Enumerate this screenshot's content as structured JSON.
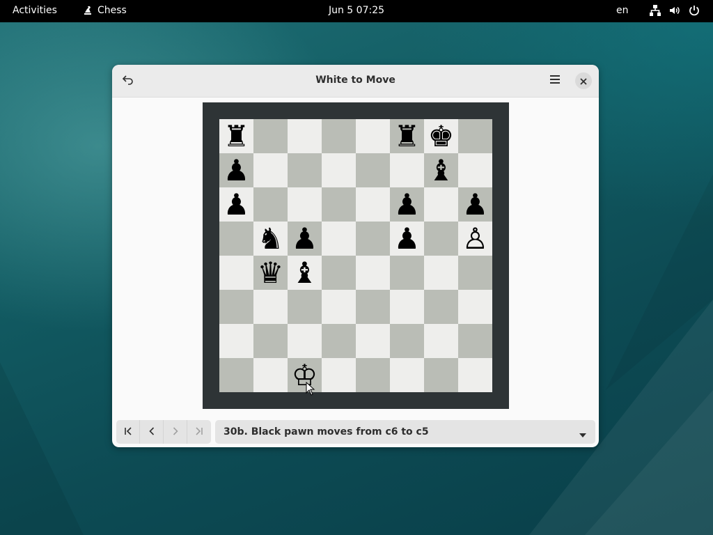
{
  "topbar": {
    "activities": "Activities",
    "app_name": "Chess",
    "clock": "Jun 5  07:25",
    "language": "en",
    "icons": [
      "network-icon",
      "volume-icon",
      "power-icon"
    ]
  },
  "window": {
    "title": "White to Move",
    "undo_icon": "undo-icon",
    "menu_icon": "hamburger-menu-icon",
    "close_icon": "close-icon"
  },
  "board": {
    "light_color": "#eeeeec",
    "dark_color": "#babdb6",
    "frame_color": "#2e3436",
    "rows": [
      [
        "♜",
        "",
        "",
        "",
        "",
        "♜",
        "♚",
        ""
      ],
      [
        "♟",
        "",
        "",
        "",
        "",
        "",
        "♝",
        ""
      ],
      [
        "♟",
        "",
        "",
        "",
        "",
        "♟",
        "",
        "♟"
      ],
      [
        "",
        "♞",
        "♟",
        "",
        "",
        "♟",
        "",
        "♙"
      ],
      [
        "",
        "♛",
        "♝",
        "",
        "",
        "",
        "",
        ""
      ],
      [
        "",
        "",
        "",
        "",
        "",
        "",
        "",
        ""
      ],
      [
        "",
        "",
        "",
        "",
        "",
        "",
        "",
        ""
      ],
      [
        "",
        "",
        "♔",
        "",
        "",
        "",
        "",
        ""
      ]
    ]
  },
  "controls": {
    "nav_icons": [
      "go-first-icon",
      "go-previous-icon",
      "go-next-icon",
      "go-last-icon"
    ],
    "history_selected": "30b. Black pawn moves from c6 to c5"
  }
}
